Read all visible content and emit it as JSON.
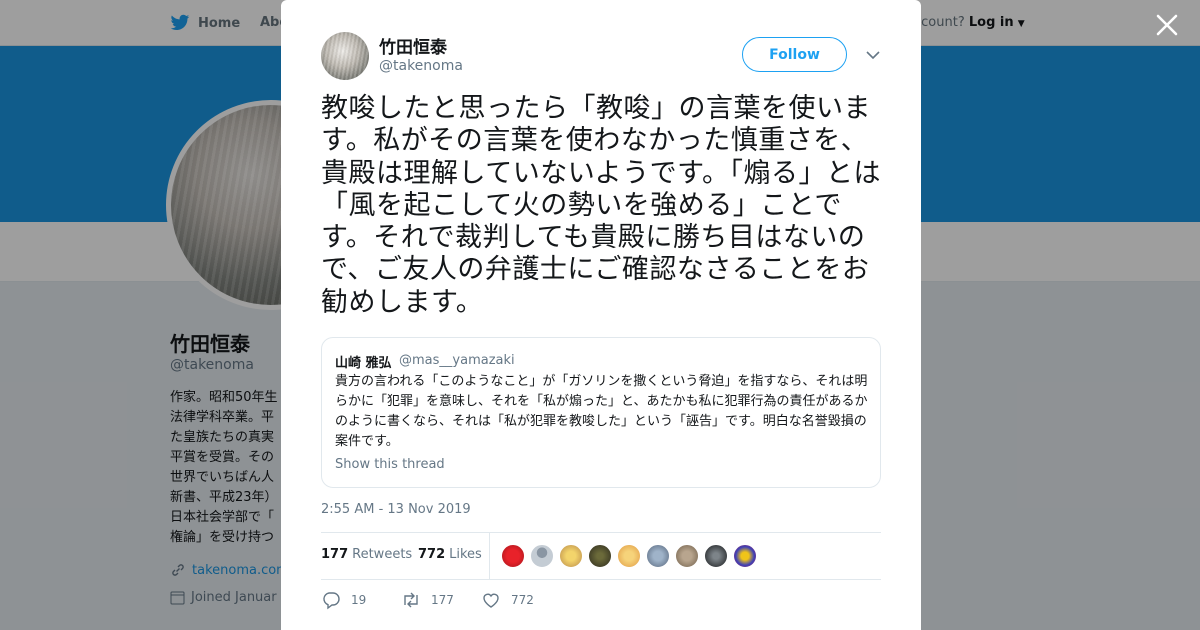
{
  "topnav": {
    "home_label": "Home",
    "about_label": "Abo",
    "account_prompt": "ccount?",
    "login_label": "Log in"
  },
  "profile": {
    "name": "竹田恒泰",
    "handle": "@takenoma",
    "bio_lines": [
      "作家。昭和50年生",
      "法律学科卒業。平",
      "た皇族たちの真実",
      "平賞を受賞。その",
      "世界でいちばん人",
      "新書、平成23年）",
      "日本社会学部で「",
      "権論」を受け持つ"
    ],
    "website": "takenoma.com",
    "joined": "Joined Januar"
  },
  "tweet": {
    "author_name": "竹田恒泰",
    "author_handle": "@takenoma",
    "follow_label": "Follow",
    "text": "教唆したと思ったら「教唆」の言葉を使います。私がその言葉を使わなかった慎重さを、貴殿は理解していないようです。「煽る」とは「風を起こして火の勢いを強める」ことです。それで裁判しても貴殿に勝ち目はないので、ご友人の弁護士にご確認なさることをお勧めします。",
    "quote": {
      "name": "山崎 雅弘",
      "handle": "@mas__yamazaki",
      "text": "貴方の言われる「このようなこと」が「ガソリンを撒くという脅迫」を指すなら、それは明らかに「犯罪」を意味し、それを「私が煽った」と、あたかも私に犯罪行為の責任があるかのように書くなら、それは「私が犯罪を教唆した」という「誣告」です。明白な名誉毀損の案件です。",
      "show_thread": "Show this thread"
    },
    "timestamp": "2:55 AM - 13 Nov 2019",
    "retweets_count": "177",
    "retweets_label": "Retweets",
    "likes_count": "772",
    "likes_label": "Likes",
    "actions": {
      "replies": "19",
      "retweets": "177",
      "likes": "772"
    }
  },
  "colors": {
    "accent": "#1da1f2",
    "banner": "#1b95e0"
  }
}
